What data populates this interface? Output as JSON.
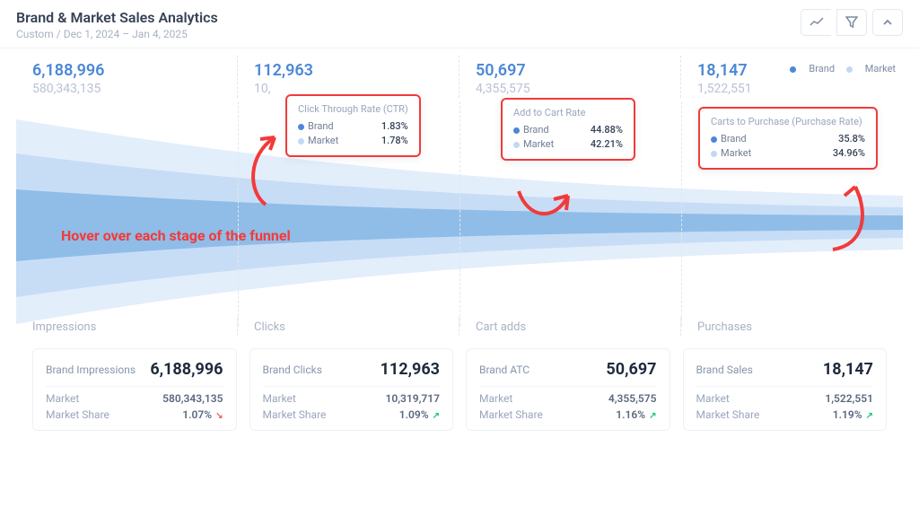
{
  "header": {
    "title": "Brand & Market Sales Analytics",
    "subtitle": "Custom / Dec 1, 2024 – Jan 4, 2025"
  },
  "legend": {
    "brand": "Brand",
    "market": "Market"
  },
  "columns": [
    {
      "brand": "6,188,996",
      "market": "580,343,135"
    },
    {
      "brand": "112,963",
      "market": "10,"
    },
    {
      "brand": "50,697",
      "market": "4,355,575"
    },
    {
      "brand": "18,147",
      "market": "1,522,551"
    }
  ],
  "tooltips": {
    "ctr": {
      "title": "Click Through Rate (CTR)",
      "brand": "1.83%",
      "market": "1.78%"
    },
    "atc": {
      "title": "Add to Cart Rate",
      "brand": "44.88%",
      "market": "42.21%"
    },
    "purch": {
      "title": "Carts to Purchase (Purchase Rate)",
      "brand": "35.8%",
      "market": "34.96%"
    }
  },
  "annotation": "Hover over each stage of the funnel",
  "stage_labels": [
    "Impressions",
    "Clicks",
    "Cart adds",
    "Purchases"
  ],
  "cards": [
    {
      "brand_label": "Brand Impressions",
      "brand_value": "6,188,996",
      "market_label": "Market",
      "market_value": "580,343,135",
      "share_label": "Market Share",
      "share_value": "1.07%",
      "share_trend": "down"
    },
    {
      "brand_label": "Brand Clicks",
      "brand_value": "112,963",
      "market_label": "Market",
      "market_value": "10,319,717",
      "share_label": "Market Share",
      "share_value": "1.09%",
      "share_trend": "up"
    },
    {
      "brand_label": "Brand ATC",
      "brand_value": "50,697",
      "market_label": "Market",
      "market_value": "4,355,575",
      "share_label": "Market Share",
      "share_value": "1.16%",
      "share_trend": "up"
    },
    {
      "brand_label": "Brand Sales",
      "brand_value": "18,147",
      "market_label": "Market",
      "market_value": "1,522,551",
      "share_label": "Market Share",
      "share_value": "1.19%",
      "share_trend": "up"
    }
  ],
  "chart_data": {
    "type": "area",
    "stages": [
      "Impressions",
      "Clicks",
      "Cart adds",
      "Purchases"
    ],
    "series": [
      {
        "name": "Market",
        "values": [
          580343135,
          10319717,
          4355575,
          1522551
        ]
      },
      {
        "name": "Brand",
        "values": [
          6188996,
          112963,
          50697,
          18147
        ]
      }
    ],
    "rates": {
      "click_through": {
        "brand": 1.83,
        "market": 1.78
      },
      "add_to_cart": {
        "brand": 44.88,
        "market": 42.21
      },
      "purchase": {
        "brand": 35.8,
        "market": 34.96
      }
    },
    "market_share": {
      "impressions": 1.07,
      "clicks": 1.09,
      "cart_adds": 1.16,
      "purchases": 1.19
    }
  }
}
